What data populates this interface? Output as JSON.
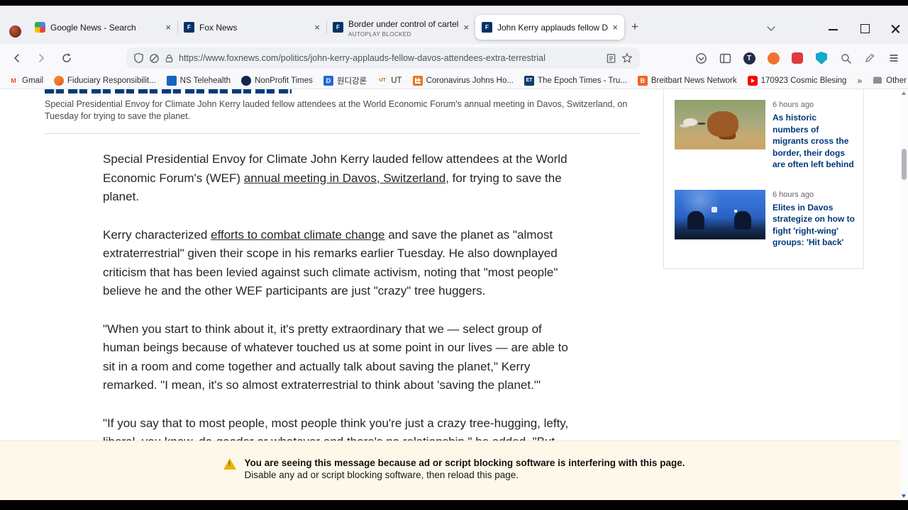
{
  "chrome": {
    "tabs": [
      {
        "title": "Google News - Search"
      },
      {
        "title": "Fox News"
      },
      {
        "title": "Border under control of cartels",
        "badge": "AUTOPLAY BLOCKED"
      },
      {
        "title": "John Kerry applauds fellow Dav"
      }
    ],
    "newtab": "+",
    "url": "https://www.foxnews.com/politics/john-kerry-applauds-fellow-davos-attendees-extra-terrestrial",
    "overflow_chevron": "»",
    "bookmarks": [
      {
        "label": "Gmail"
      },
      {
        "label": "Fiduciary Responsibilit..."
      },
      {
        "label": "NS Telehealth"
      },
      {
        "label": "NonProfit Times"
      },
      {
        "label": "원디강론"
      },
      {
        "label": "UT"
      },
      {
        "label": "Coronavirus Johns Ho..."
      },
      {
        "label": "The Epoch Times - Tru..."
      },
      {
        "label": "Breitbart News Network"
      },
      {
        "label": "170923 Cosmic Blesing"
      },
      {
        "label": "Other Bookmarks"
      }
    ],
    "close_glyph": "×"
  },
  "article": {
    "dek": "Special Presidential Envoy for Climate John Kerry lauded fellow attendees at the World Economic Forum's annual meeting in Davos, Switzerland, on Tuesday for trying to save the planet.",
    "p1_pre": "Special Presidential Envoy for Climate John Kerry lauded fellow attendees at the World Economic Forum's (WEF) ",
    "p1_link": "annual meeting in Davos, Switzerland",
    "p1_post": ", for trying to save the planet.",
    "p2_pre": "Kerry characterized ",
    "p2_link": "efforts to combat climate change",
    "p2_post": " and save the planet as \"almost extraterrestrial\" given their scope in his remarks earlier Tuesday. He also downplayed criticism that has been levied against such climate activism, noting that \"most people\" believe he and the other WEF participants are just \"crazy\" tree huggers.",
    "p3": "\"When you start to think about it, it's pretty extraordinary that we — select group of human beings because of whatever touched us at some point in our lives — are able to sit in a room and come together and actually talk about saving the planet,\" Kerry remarked. \"I mean, it's so almost extraterrestrial to think about 'saving the planet.'\"",
    "p4": "\"If you say that to most people, most people think you're just a crazy tree-hugging, lefty, liberal, you know, do-gooder or whatever and there's no relationship,\" he added. \"But really"
  },
  "sidebar": {
    "items": [
      {
        "time": "6 hours ago",
        "title": "As historic numbers of migrants cross the border, their dogs are often left behind"
      },
      {
        "time": "6 hours ago",
        "title": "Elites in Davos strategize on how to fight 'right-wing' groups: 'Hit back'"
      }
    ]
  },
  "banner": {
    "line1": "You are seeing this message because ad or script blocking software is interfering with this page.",
    "line2": "Disable any ad or script blocking software, then reload this page."
  },
  "colors": {
    "headline_blue": "#00387b",
    "banner_bg": "#fdf8e9",
    "warning_yellow": "#eab308"
  }
}
